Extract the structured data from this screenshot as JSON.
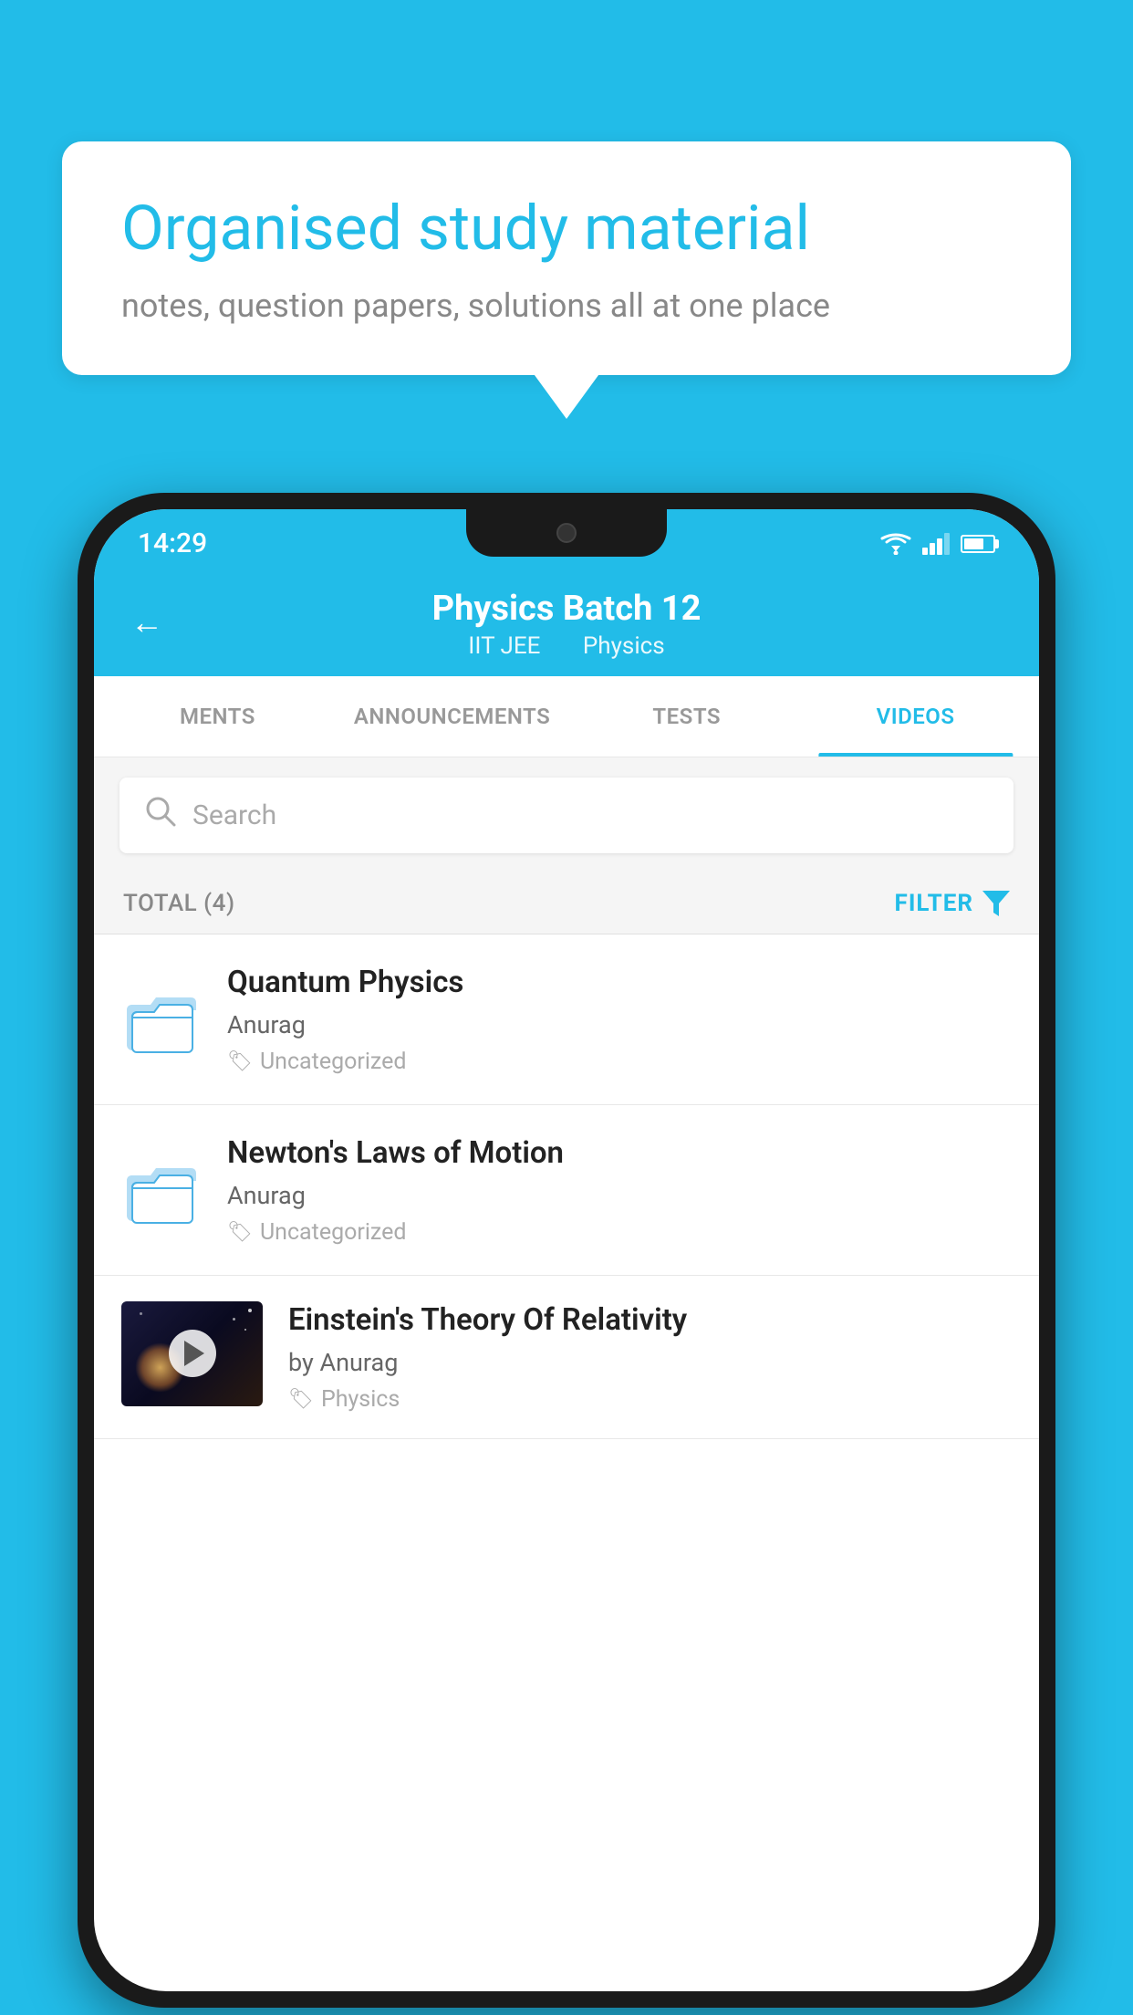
{
  "background_color": "#22bce8",
  "speech_bubble": {
    "title": "Organised study material",
    "subtitle": "notes, question papers, solutions all at one place"
  },
  "status_bar": {
    "time": "14:29"
  },
  "app_header": {
    "title": "Physics Batch 12",
    "subtitle_part1": "IIT JEE",
    "subtitle_part2": "Physics",
    "back_label": "←"
  },
  "tabs": [
    {
      "label": "MENTS",
      "active": false
    },
    {
      "label": "ANNOUNCEMENTS",
      "active": false
    },
    {
      "label": "TESTS",
      "active": false
    },
    {
      "label": "VIDEOS",
      "active": true
    }
  ],
  "search": {
    "placeholder": "Search"
  },
  "total": {
    "label": "TOTAL (4)",
    "filter_label": "FILTER"
  },
  "videos": [
    {
      "title": "Quantum Physics",
      "author": "Anurag",
      "tag": "Uncategorized",
      "type": "folder"
    },
    {
      "title": "Newton's Laws of Motion",
      "author": "Anurag",
      "tag": "Uncategorized",
      "type": "folder"
    },
    {
      "title": "Einstein's Theory Of Relativity",
      "author": "by Anurag",
      "tag": "Physics",
      "type": "video"
    }
  ]
}
